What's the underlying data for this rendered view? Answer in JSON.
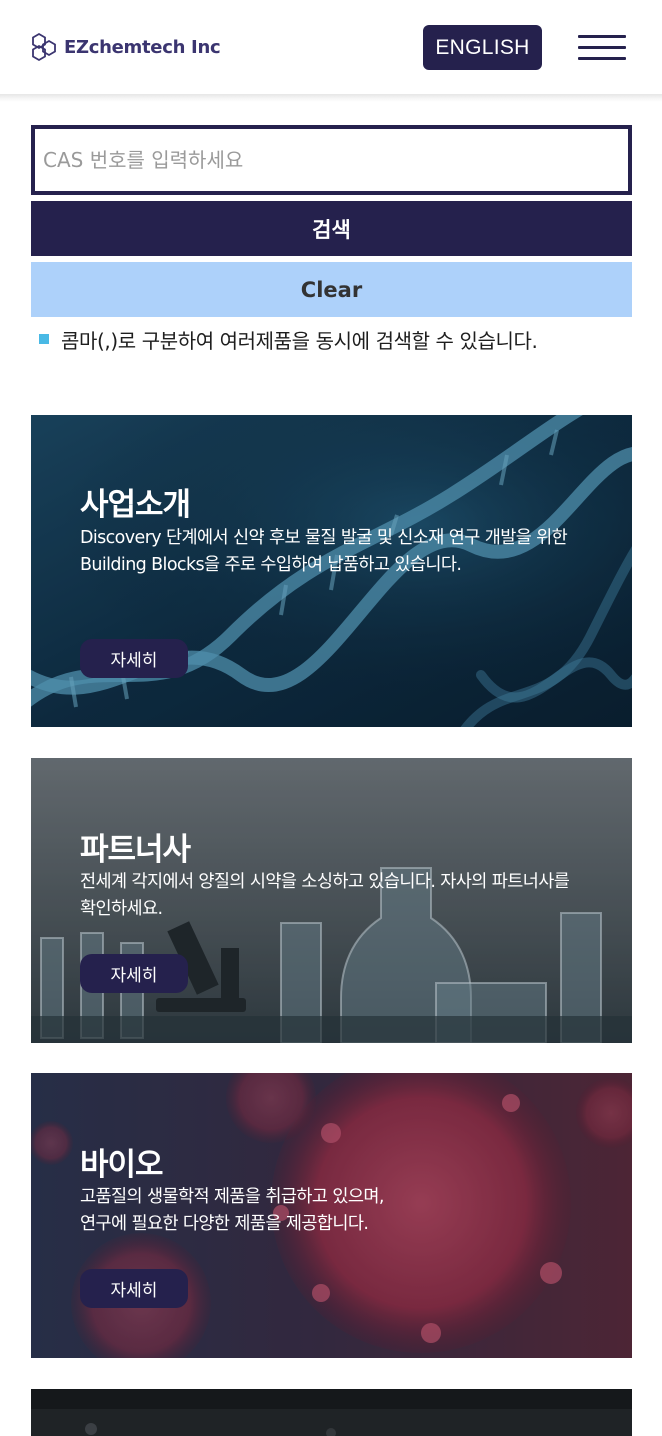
{
  "header": {
    "logo_text": "EZchemtech Inc",
    "lang_button": "ENGLISH",
    "menu_icon": "hamburger-menu-icon",
    "logo_icon": "hexagon-molecule-icon"
  },
  "search": {
    "placeholder": "CAS 번호를 입력하세요",
    "value": "",
    "search_label": "검색",
    "clear_label": "Clear",
    "hint": "콤마(,)로 구분하여 여러제품을 동시에 검색할 수 있습니다."
  },
  "cards": [
    {
      "title": "사업소개",
      "description": "Discovery 단계에서 신약 후보 물질 발굴 및 신소재 연구 개발을 위한 Building Blocks을 주로 수입하여 납품하고 있습니다.",
      "button": "자세히",
      "image": "dna-helix"
    },
    {
      "title": "파트너사",
      "description": "전세계 각지에서 양질의 시약을 소싱하고 있습니다. 자사의 파트너사를 확인하세요.",
      "button": "자세히",
      "image": "lab-glassware"
    },
    {
      "title": "바이오",
      "description_line1": "고품질의 생물학적 제품을 취급하고 있으며,",
      "description_line2": "연구에 필요한 다양한 제품을 제공합니다.",
      "button": "자세히",
      "image": "virus-particles"
    }
  ],
  "colors": {
    "primary": "#25214d",
    "clear_button": "#add1fa",
    "hint_bullet": "#49b9e5"
  }
}
